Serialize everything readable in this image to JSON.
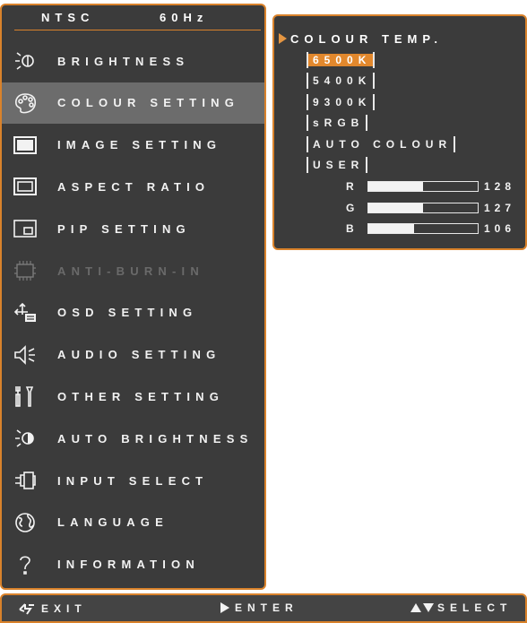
{
  "header": {
    "mode": "NTSC",
    "freq": "60Hz"
  },
  "menu": [
    {
      "label": "BRIGHTNESS",
      "icon": "brightness-icon",
      "state": "normal"
    },
    {
      "label": "COLOUR SETTING",
      "icon": "palette-icon",
      "state": "selected"
    },
    {
      "label": "IMAGE SETTING",
      "icon": "image-icon",
      "state": "normal"
    },
    {
      "label": "ASPECT RATIO",
      "icon": "aspect-ratio-icon",
      "state": "normal"
    },
    {
      "label": "PIP SETTING",
      "icon": "pip-icon",
      "state": "normal"
    },
    {
      "label": "ANTI-BURN-IN",
      "icon": "chip-icon",
      "state": "disabled"
    },
    {
      "label": "OSD SETTING",
      "icon": "osd-icon",
      "state": "normal"
    },
    {
      "label": "AUDIO SETTING",
      "icon": "speaker-icon",
      "state": "normal"
    },
    {
      "label": "OTHER SETTING",
      "icon": "tools-icon",
      "state": "normal"
    },
    {
      "label": "AUTO BRIGHTNESS",
      "icon": "auto-brightness-icon",
      "state": "normal"
    },
    {
      "label": "INPUT SELECT",
      "icon": "input-plug-icon",
      "state": "normal"
    },
    {
      "label": "LANGUAGE",
      "icon": "globe-icon",
      "state": "normal"
    },
    {
      "label": "INFORMATION",
      "icon": "question-icon",
      "state": "normal"
    }
  ],
  "colour_temp": {
    "title": "COLOUR TEMP.",
    "options": [
      "6500K",
      "5400K",
      "9300K",
      "sRGB",
      "AUTO COLOUR",
      "USER"
    ],
    "selected": "6500K"
  },
  "rgb": [
    {
      "label": "R",
      "value": "128",
      "level": 0.5
    },
    {
      "label": "G",
      "value": "127",
      "level": 0.5
    },
    {
      "label": "B",
      "value": "106",
      "level": 0.42
    }
  ],
  "footer": {
    "exit": "EXIT",
    "enter": "ENTER",
    "select": "SELECT"
  },
  "colors": {
    "accent": "#d9822b",
    "panel": "#3b3b3b",
    "highlight": "#e2882d"
  }
}
